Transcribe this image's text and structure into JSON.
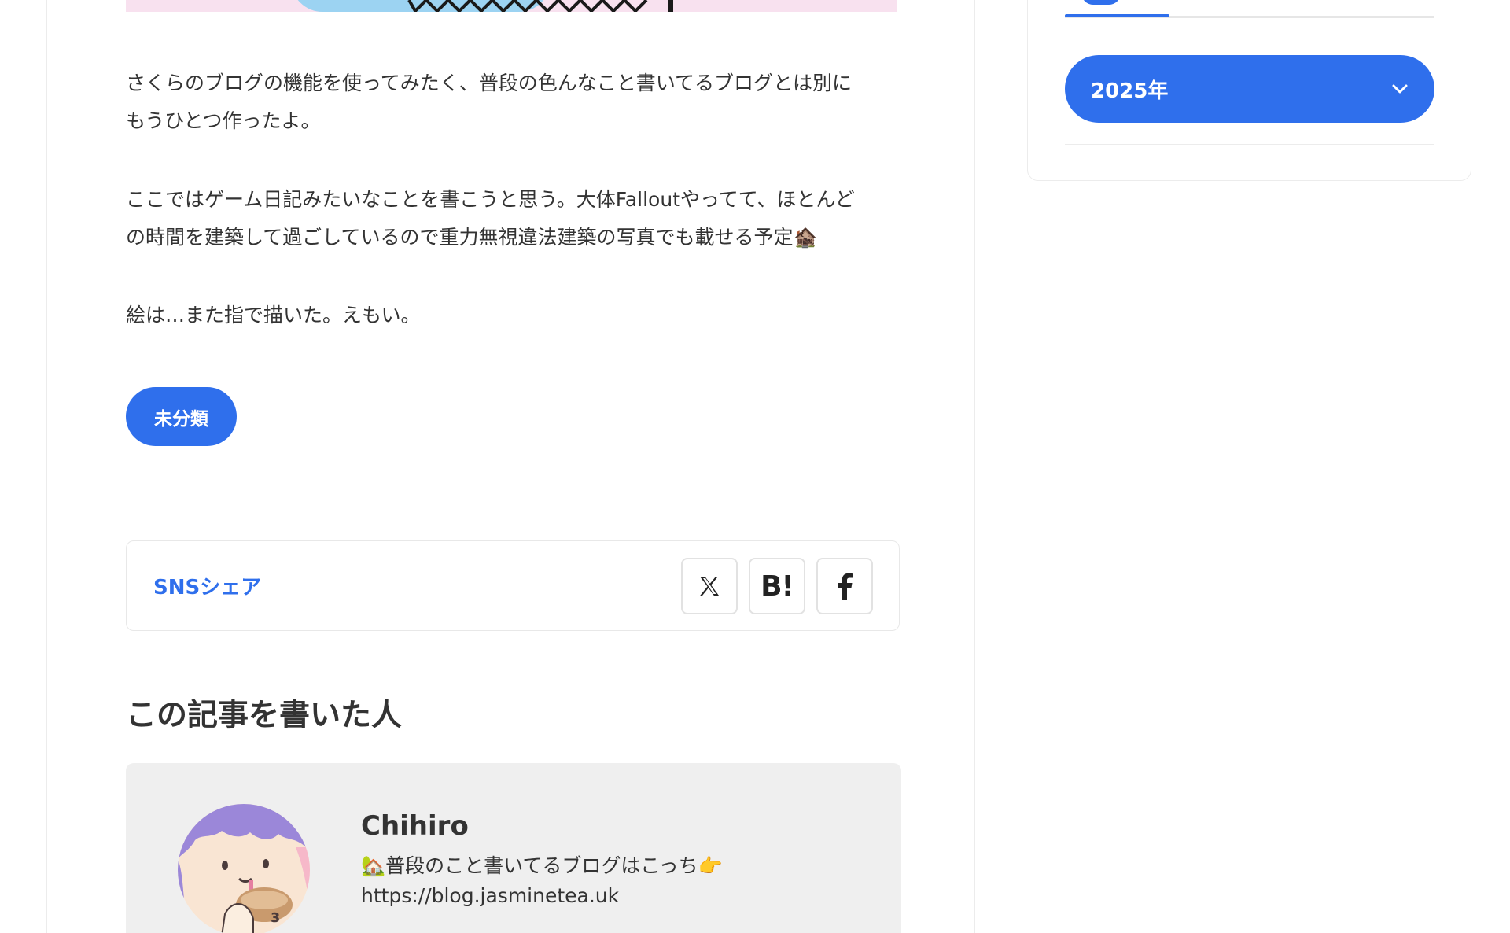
{
  "article": {
    "paragraphs": [
      [
        "さくらのブログの機能を使ってみたく、普段の色んなこと書いてるブログとは別に",
        "もうひとつ作ったよ。"
      ],
      [
        "ここではゲーム日記みたいなことを書こうと思う。大体Falloutやってて、ほとんど",
        "の時間を建築して過ごしているので重力無視違法建築の写真でも載せる予定🏚️"
      ],
      [
        "絵は…また指で描いた。えもい。"
      ]
    ],
    "category": "未分類"
  },
  "share": {
    "label": "SNSシェア",
    "buttons": [
      {
        "icon": "x-icon",
        "label": "𝕏"
      },
      {
        "icon": "hatena-bookmark-icon",
        "label": "B!"
      },
      {
        "icon": "facebook-icon",
        "label": "f"
      }
    ]
  },
  "author": {
    "heading": "この記事を書いた人",
    "name": "Chihiro",
    "bio_line1": "🏡普段のこと書いてるブログはこっち👉",
    "bio_line2": "https://blog.jasminetea.uk"
  },
  "sidebar": {
    "archive_select": "2025年"
  },
  "colors": {
    "accent": "#2f6fec",
    "text": "#333333",
    "author_bg": "#efefef"
  }
}
